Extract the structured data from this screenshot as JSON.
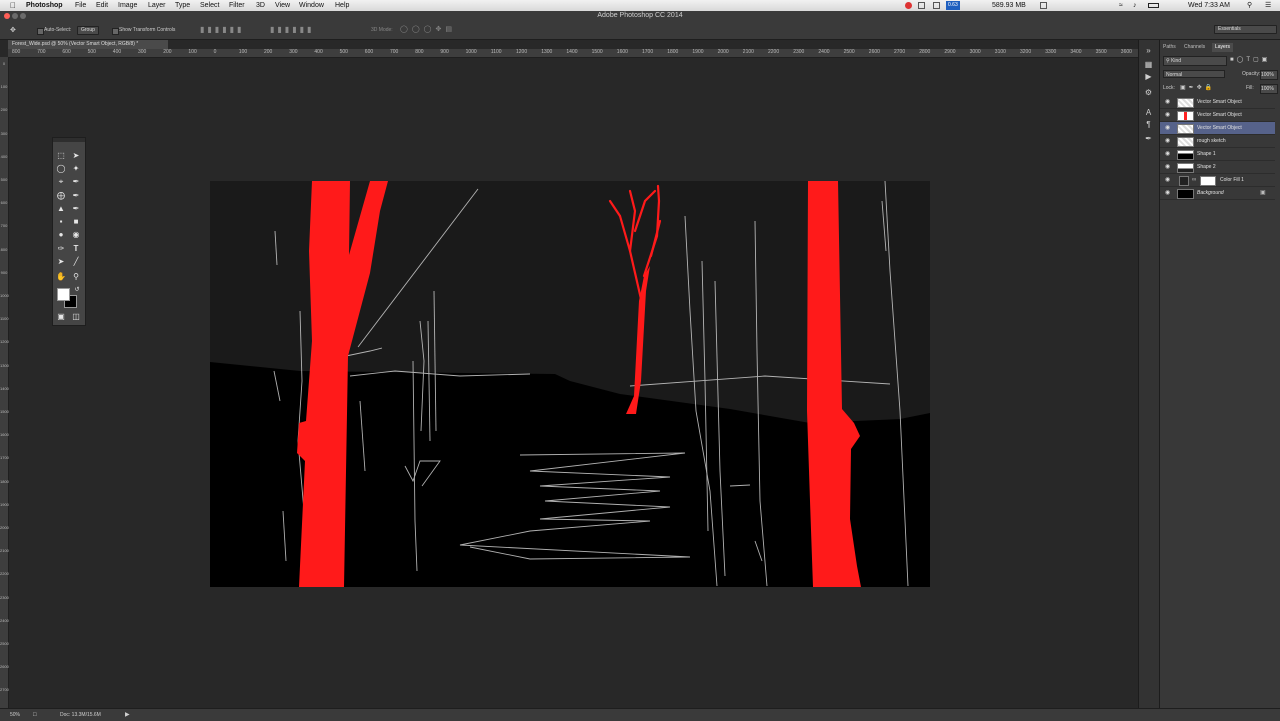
{
  "menubar": {
    "app_name": "Photoshop",
    "items": [
      "File",
      "Edit",
      "Image",
      "Layer",
      "Type",
      "Select",
      "Filter",
      "3D",
      "View",
      "Window",
      "Help"
    ],
    "memory": "589.93 MB",
    "clock": "Wed 7:33 AM",
    "badge": "0.63"
  },
  "window": {
    "title": "Adobe Photoshop CC 2014"
  },
  "options": {
    "auto_select_label": "Auto-Select:",
    "auto_select_value": "Group",
    "transform_label": "Show Transform Controls",
    "mode_3d_label": "3D Mode:",
    "workspace": "Essentials"
  },
  "document": {
    "tab_title": "Forest_Wide.psd @ 50% (Vector Smart Object, RGB/8) *"
  },
  "rulers": {
    "h": [
      "800",
      "700",
      "600",
      "500",
      "400",
      "300",
      "200",
      "100",
      "0",
      "100",
      "200",
      "300",
      "400",
      "500",
      "600",
      "700",
      "800",
      "900",
      "1000",
      "1100",
      "1200",
      "1300",
      "1400",
      "1500",
      "1600",
      "1700",
      "1800",
      "1900",
      "2000",
      "2100",
      "2200",
      "2300",
      "2400",
      "2500",
      "2600",
      "2700",
      "2800",
      "2900",
      "3000",
      "3100",
      "3200",
      "3300",
      "3400",
      "3500",
      "3600"
    ],
    "v": [
      "0",
      "100",
      "200",
      "300",
      "400",
      "500",
      "600",
      "700",
      "800",
      "900",
      "1000",
      "1100",
      "1200",
      "1300",
      "1400",
      "1500",
      "1600",
      "1700",
      "1800",
      "1900",
      "2000",
      "2100",
      "2200",
      "2300",
      "2400",
      "2500",
      "2600",
      "2700"
    ]
  },
  "panel": {
    "tabs": [
      "Paths",
      "Channels",
      "Layers"
    ],
    "filter_kind": "Kind",
    "blend_mode": "Normal",
    "opacity_label": "Opacity:",
    "opacity_value": "100%",
    "lock_label": "Lock:",
    "fill_label": "Fill:",
    "fill_value": "100%",
    "layers": [
      {
        "name": "Vector Smart Object",
        "selected": false
      },
      {
        "name": "Vector Smart Object",
        "selected": false
      },
      {
        "name": "Vector Smart Object",
        "selected": true
      },
      {
        "name": "rough sketch",
        "selected": false
      },
      {
        "name": "Shape 1",
        "selected": false
      },
      {
        "name": "Shape 2",
        "selected": false
      },
      {
        "name": "Color Fill 1",
        "selected": false
      },
      {
        "name": "Background",
        "selected": false
      }
    ]
  },
  "status": {
    "zoom": "50%",
    "doc": "Doc: 13.3M/15.6M"
  },
  "colors": {
    "tree_red": "#ff1a1a",
    "canvas_black": "#000000",
    "sky_dark": "#1a1a1a",
    "selection_blue": "#56628a"
  }
}
